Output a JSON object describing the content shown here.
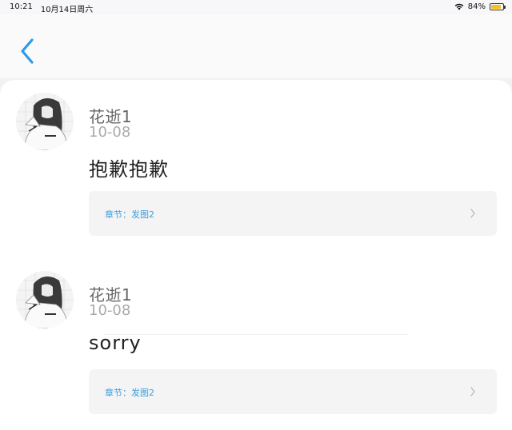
{
  "status_bar": {
    "time": "10:21",
    "date": "10月14日周六",
    "battery": "84%",
    "battery_level": 0.84,
    "icons": [
      "wifi-icon",
      "battery-icon"
    ]
  },
  "nav": {
    "back_icon": "chevron-left-icon",
    "accent_color": "#2f9ae6"
  },
  "comments": [
    {
      "username": "花逝1",
      "date": "10-08",
      "text": "抱歉抱歉",
      "chapter": "章节：发图2",
      "chapter_icon": "chevron-right-icon"
    },
    {
      "username": "花逝1",
      "date": "10-08",
      "text": "sorry",
      "chapter": "章节：发图2",
      "chapter_icon": "chevron-right-icon"
    }
  ],
  "colors": {
    "chapter_text": "#3a9fdb",
    "battery": "#f4c21c"
  }
}
